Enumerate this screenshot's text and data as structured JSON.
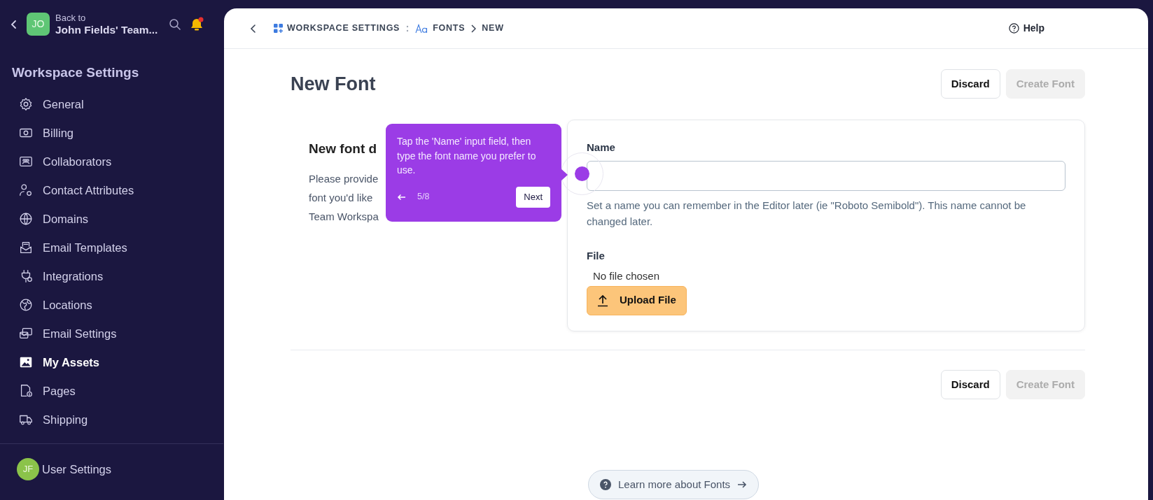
{
  "sidebar": {
    "avatar_initials": "JO",
    "back_to_label": "Back to",
    "workspace_name": "John Fields' Team...",
    "has_notification": true,
    "section_title": "Workspace Settings",
    "items": [
      {
        "label": "General",
        "selected": false
      },
      {
        "label": "Billing",
        "selected": false
      },
      {
        "label": "Collaborators",
        "selected": false
      },
      {
        "label": "Contact Attributes",
        "selected": false
      },
      {
        "label": "Domains",
        "selected": false
      },
      {
        "label": "Email Templates",
        "selected": false
      },
      {
        "label": "Integrations",
        "selected": false
      },
      {
        "label": "Locations",
        "selected": false
      },
      {
        "label": "Email Settings",
        "selected": false
      },
      {
        "label": "My Assets",
        "selected": true
      },
      {
        "label": "Pages",
        "selected": false
      },
      {
        "label": "Shipping",
        "selected": false
      }
    ],
    "user_settings": {
      "avatar_initials": "JF",
      "label": "User Settings"
    }
  },
  "breadcrumb": [
    {
      "label": "WORKSPACE SETTINGS",
      "kind": "grid"
    },
    {
      "label": "FONTS",
      "kind": "font"
    },
    {
      "label": "NEW",
      "kind": "plain"
    }
  ],
  "help_label": "Help",
  "page_title": "New Font",
  "top_actions": [
    {
      "label": "Discard",
      "disabled": false
    },
    {
      "label": "Create Font",
      "disabled": true
    }
  ],
  "section": {
    "heading": "New font d",
    "description_lines": [
      "Please provide",
      "font you'd like",
      "Team Workspa"
    ]
  },
  "form": {
    "name_label": "Name",
    "name_help": "Set a name you can remember in the Editor later (ie \"Roboto Semibold\"). This name cannot be changed later.",
    "file_label": "File",
    "file_status": "No file chosen",
    "upload_label": "Upload File"
  },
  "bottom_actions": [
    {
      "label": "Discard",
      "disabled": false
    },
    {
      "label": "Create Font",
      "disabled": true
    }
  ],
  "learn_more": "Learn more about Fonts",
  "tour_tooltip": {
    "text": "Tap the 'Name' input field, then type the font name you prefer to use.",
    "step": "5/8",
    "next_label": "Next"
  }
}
